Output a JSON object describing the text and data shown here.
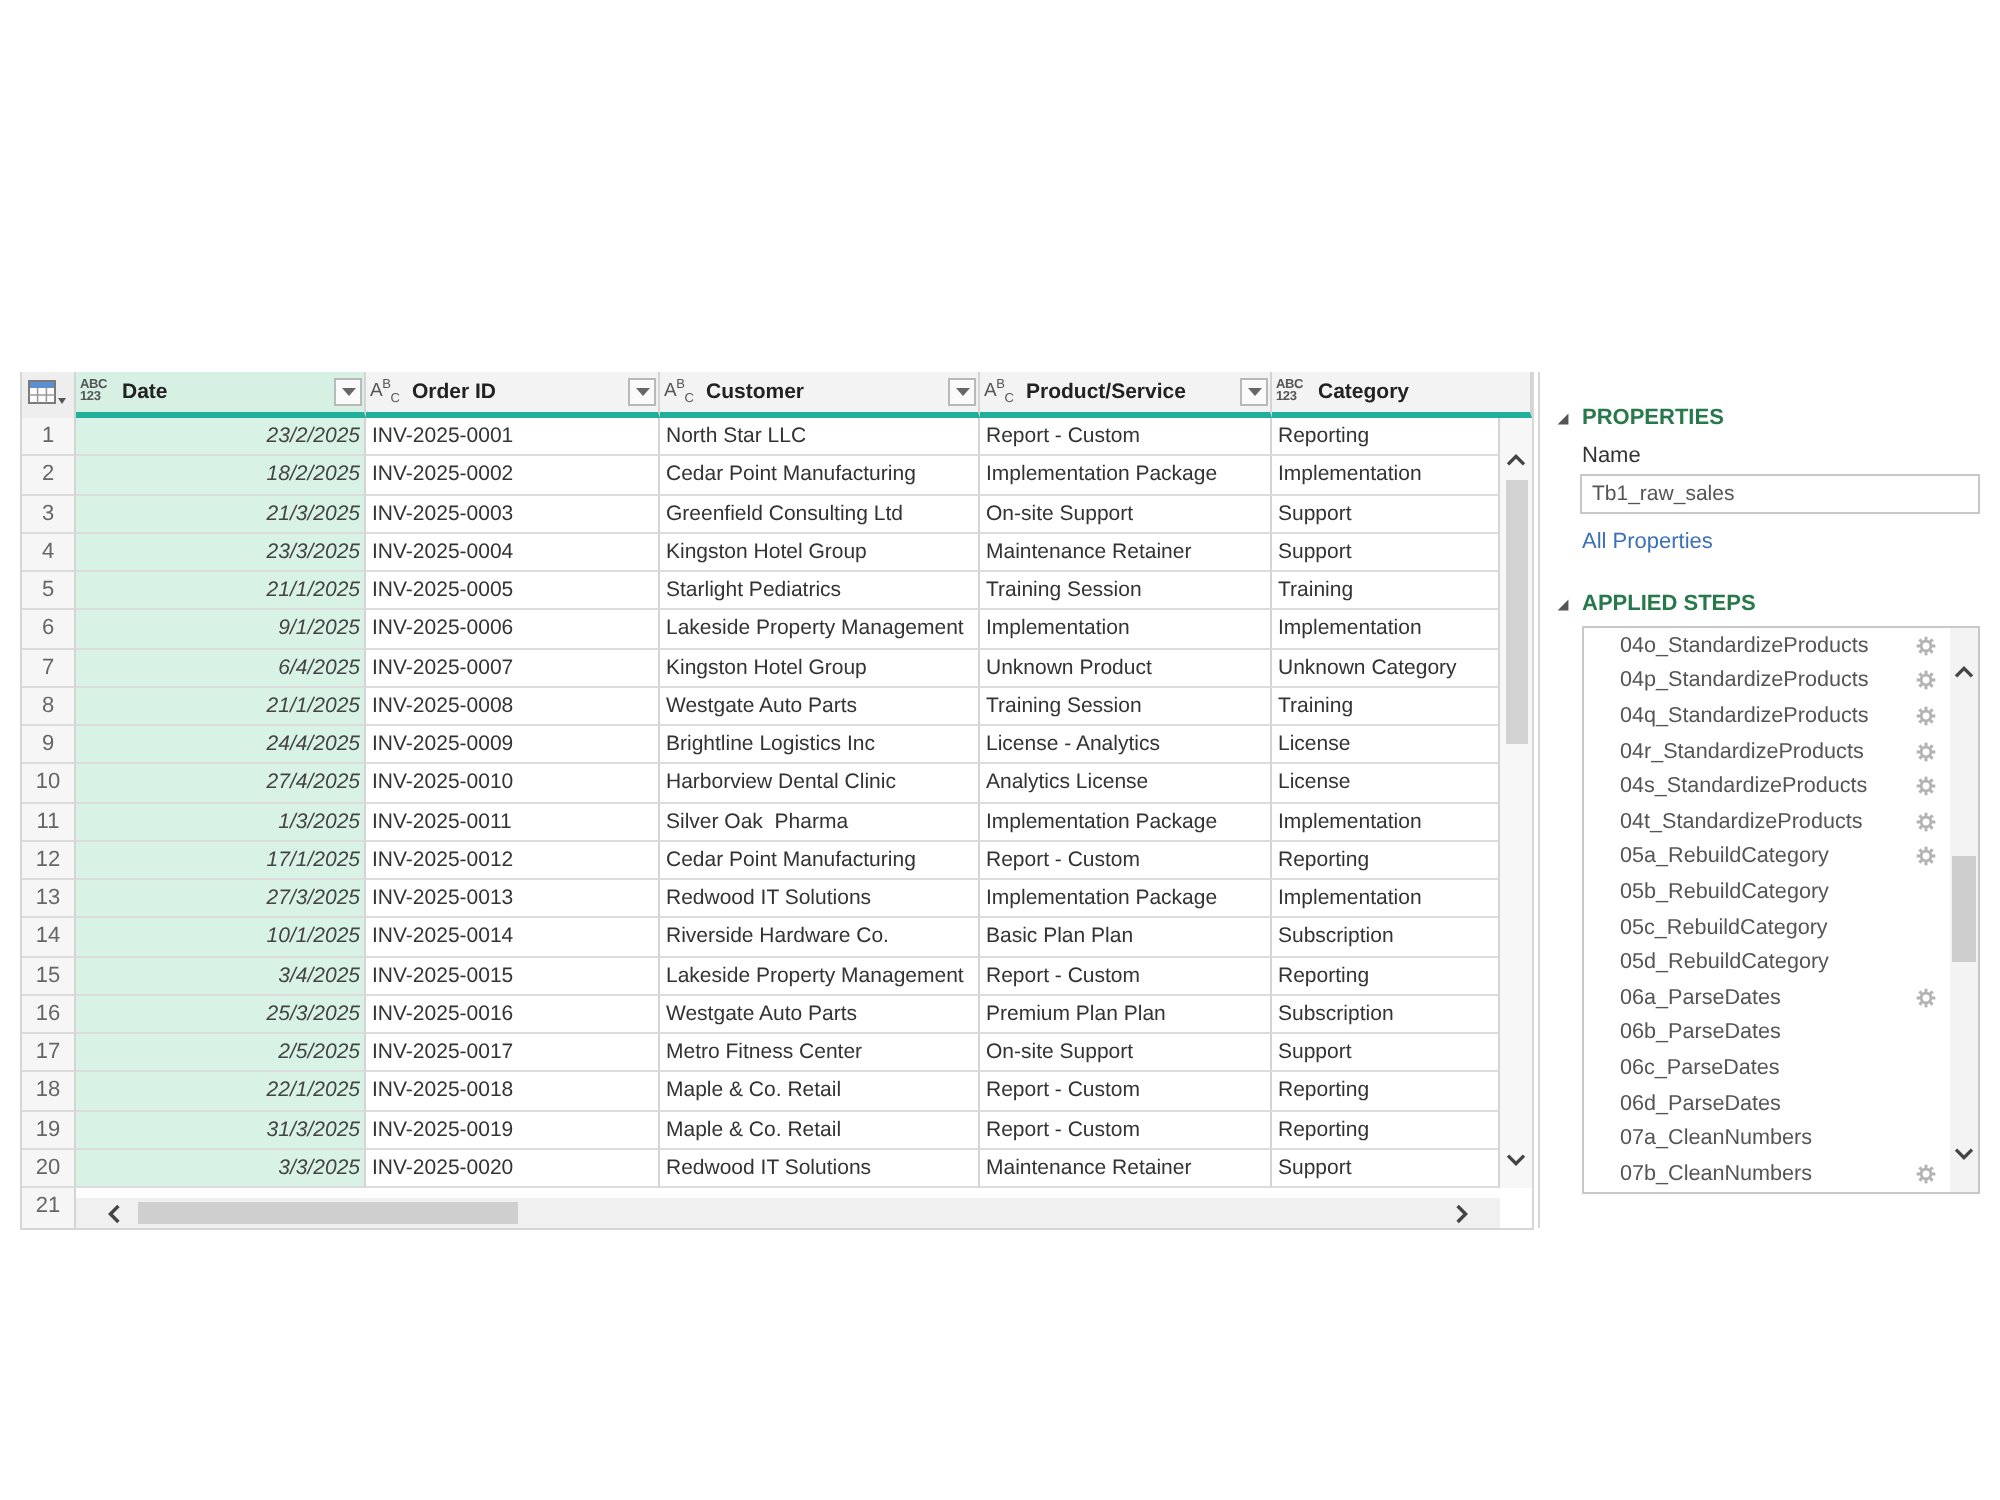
{
  "table": {
    "columns": [
      {
        "label": "Date",
        "type_icon": [
          "ABC",
          "123"
        ],
        "kind": "date",
        "selected": true,
        "filter_button": true
      },
      {
        "label": "Order ID",
        "type_icon": [
          "A$^{B}$$_{C}$"
        ],
        "kind": "text",
        "selected": false,
        "filter_button": true
      },
      {
        "label": "Customer",
        "type_icon": [
          "A$^{B}$$_{C}$"
        ],
        "kind": "text",
        "selected": false,
        "filter_button": true
      },
      {
        "label": "Product/Service",
        "type_icon": [
          "A$^{B}$$_{C}$"
        ],
        "kind": "text",
        "selected": false,
        "filter_button": true
      },
      {
        "label": "Category",
        "type_icon": [
          "ABC",
          "123"
        ],
        "kind": "text",
        "selected": false,
        "filter_button": false
      }
    ],
    "rows": [
      {
        "number": "1",
        "cells": [
          "23/2/2025",
          "INV-2025-0001",
          "North Star LLC",
          "Report - Custom",
          "Reporting"
        ]
      },
      {
        "number": "2",
        "cells": [
          "18/2/2025",
          "INV-2025-0002",
          "Cedar Point Manufacturing",
          "Implementation Package",
          "Implementation"
        ]
      },
      {
        "number": "3",
        "cells": [
          "21/3/2025",
          "INV-2025-0003",
          "Greenfield Consulting Ltd",
          "On-site Support",
          "Support"
        ]
      },
      {
        "number": "4",
        "cells": [
          "23/3/2025",
          "INV-2025-0004",
          "Kingston Hotel Group",
          "Maintenance Retainer",
          "Support"
        ]
      },
      {
        "number": "5",
        "cells": [
          "21/1/2025",
          "INV-2025-0005",
          "Starlight Pediatrics",
          "Training Session",
          "Training"
        ]
      },
      {
        "number": "6",
        "cells": [
          "9/1/2025",
          "INV-2025-0006",
          "Lakeside Property Management",
          "Implementation",
          "Implementation"
        ]
      },
      {
        "number": "7",
        "cells": [
          "6/4/2025",
          "INV-2025-0007",
          "Kingston Hotel Group",
          "Unknown Product",
          "Unknown Category"
        ]
      },
      {
        "number": "8",
        "cells": [
          "21/1/2025",
          "INV-2025-0008",
          "Westgate Auto Parts",
          "Training Session",
          "Training"
        ]
      },
      {
        "number": "9",
        "cells": [
          "24/4/2025",
          "INV-2025-0009",
          "Brightline Logistics Inc",
          "License - Analytics",
          "License"
        ]
      },
      {
        "number": "10",
        "cells": [
          "27/4/2025",
          "INV-2025-0010",
          "Harborview Dental Clinic",
          "Analytics License",
          "License"
        ]
      },
      {
        "number": "11",
        "cells": [
          "1/3/2025",
          "INV-2025-0011",
          "Silver Oak  Pharma",
          "Implementation Package",
          "Implementation"
        ]
      },
      {
        "number": "12",
        "cells": [
          "17/1/2025",
          "INV-2025-0012",
          "Cedar Point Manufacturing",
          "Report - Custom",
          "Reporting"
        ]
      },
      {
        "number": "13",
        "cells": [
          "27/3/2025",
          "INV-2025-0013",
          "Redwood IT Solutions",
          "Implementation Package",
          "Implementation"
        ]
      },
      {
        "number": "14",
        "cells": [
          "10/1/2025",
          "INV-2025-0014",
          "Riverside Hardware Co.",
          "Basic Plan Plan",
          "Subscription"
        ]
      },
      {
        "number": "15",
        "cells": [
          "3/4/2025",
          "INV-2025-0015",
          "Lakeside Property Management",
          "Report - Custom",
          "Reporting"
        ]
      },
      {
        "number": "16",
        "cells": [
          "25/3/2025",
          "INV-2025-0016",
          "Westgate Auto Parts",
          "Premium Plan Plan",
          "Subscription"
        ]
      },
      {
        "number": "17",
        "cells": [
          "2/5/2025",
          "INV-2025-0017",
          "Metro Fitness Center",
          "On-site Support",
          "Support"
        ]
      },
      {
        "number": "18",
        "cells": [
          "22/1/2025",
          "INV-2025-0018",
          "Maple & Co. Retail",
          "Report - Custom",
          "Reporting"
        ]
      },
      {
        "number": "19",
        "cells": [
          "31/3/2025",
          "INV-2025-0019",
          "Maple & Co. Retail",
          "Report - Custom",
          "Reporting"
        ]
      },
      {
        "number": "20",
        "cells": [
          "3/3/2025",
          "INV-2025-0020",
          "Redwood IT Solutions",
          "Maintenance Retainer",
          "Support"
        ]
      }
    ],
    "partial_row": {
      "number": "21"
    }
  },
  "query_settings": {
    "properties": {
      "title": "PROPERTIES",
      "expanded": true,
      "name_label": "Name",
      "name_value": "Tb1_raw_sales",
      "link": "All Properties"
    },
    "applied_steps": {
      "title": "APPLIED STEPS",
      "expanded": true,
      "steps": [
        {
          "label": "04o_StandardizeProducts",
          "has_settings": true
        },
        {
          "label": "04p_StandardizeProducts",
          "has_settings": true
        },
        {
          "label": "04q_StandardizeProducts",
          "has_settings": true
        },
        {
          "label": "04r_StandardizeProducts",
          "has_settings": true
        },
        {
          "label": "04s_StandardizeProducts",
          "has_settings": true
        },
        {
          "label": "04t_StandardizeProducts",
          "has_settings": true
        },
        {
          "label": "05a_RebuildCategory",
          "has_settings": true
        },
        {
          "label": "05b_RebuildCategory",
          "has_settings": false
        },
        {
          "label": "05c_RebuildCategory",
          "has_settings": false
        },
        {
          "label": "05d_RebuildCategory",
          "has_settings": false
        },
        {
          "label": "06a_ParseDates",
          "has_settings": true
        },
        {
          "label": "06b_ParseDates",
          "has_settings": false
        },
        {
          "label": "06c_ParseDates",
          "has_settings": false
        },
        {
          "label": "06d_ParseDates",
          "has_settings": false
        },
        {
          "label": "07a_CleanNumbers",
          "has_settings": false
        },
        {
          "label": "07b_CleanNumbers",
          "has_settings": true
        }
      ]
    }
  }
}
